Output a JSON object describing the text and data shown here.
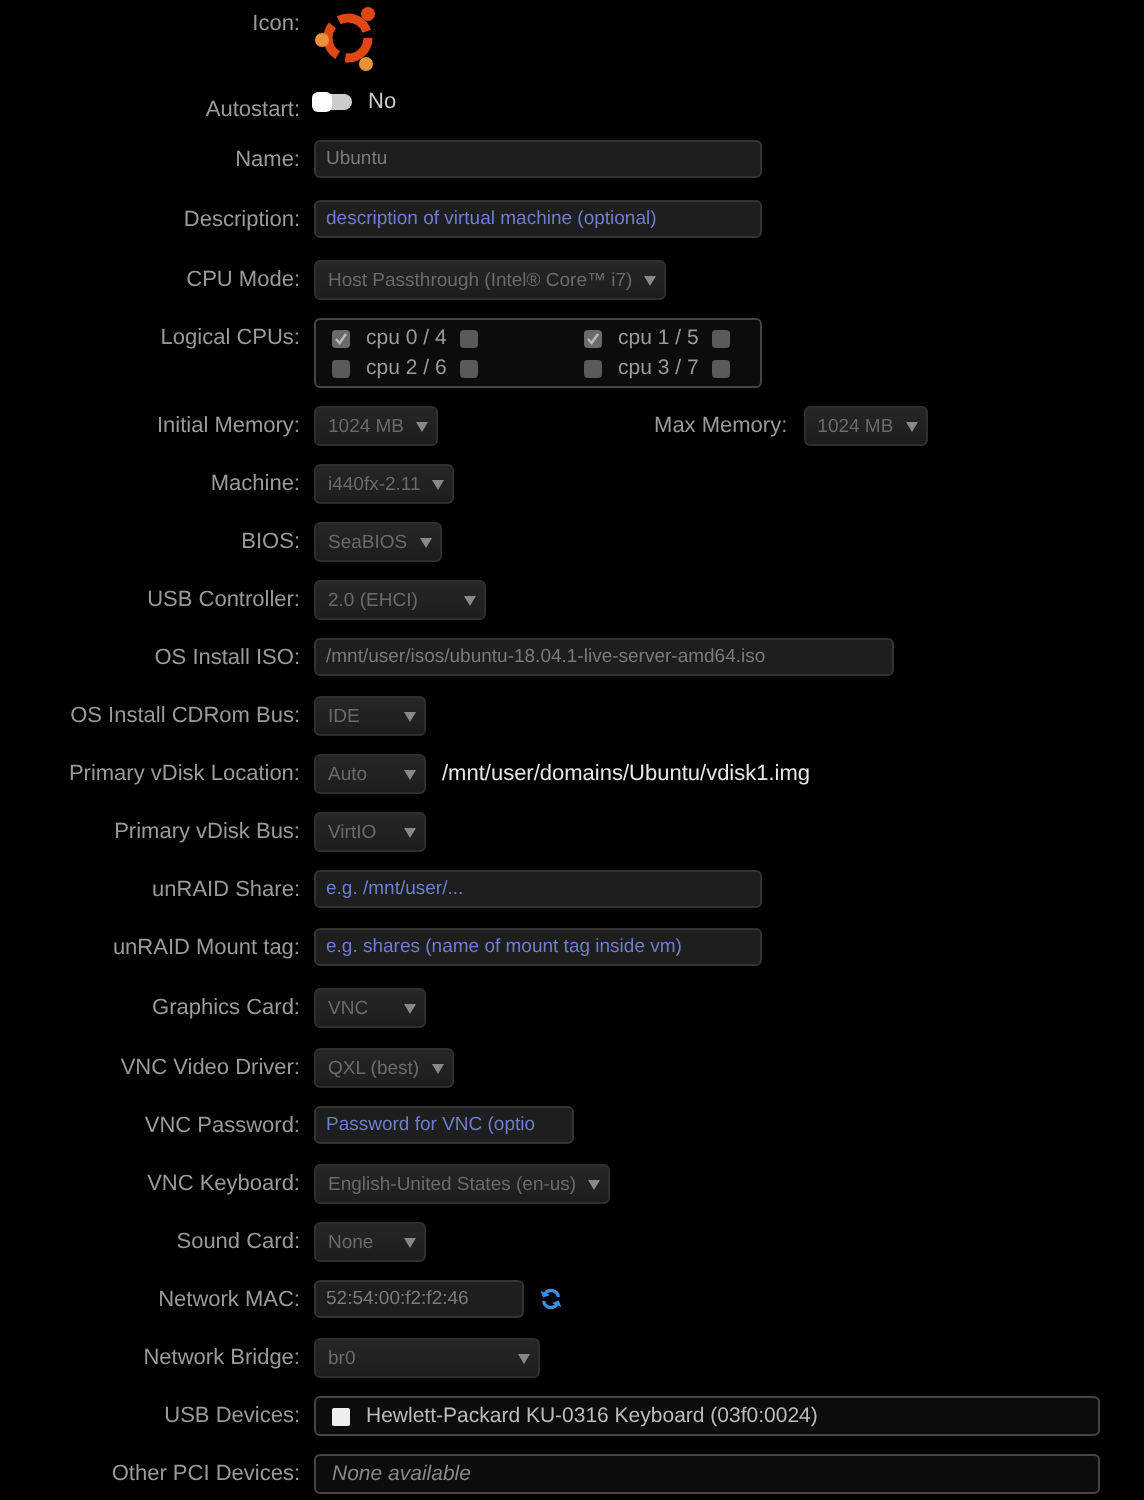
{
  "rows": [
    {
      "kind": "icon",
      "label": "Icon:"
    },
    {
      "kind": "toggle",
      "label": "Autostart:",
      "on": false,
      "state_text": "No"
    },
    {
      "kind": "text",
      "label": "Name:",
      "value": "Ubuntu"
    },
    {
      "kind": "text",
      "label": "Description:",
      "placeholder": "description of virtual machine (optional)"
    },
    {
      "kind": "select",
      "label": "CPU Mode:",
      "value": "Host Passthrough (Intel® Core™ i7)"
    },
    {
      "kind": "cpus",
      "label": "Logical CPUs:",
      "cpus": [
        {
          "label": "cpu 0 / 4",
          "checked": true,
          "sibling_checked": false
        },
        {
          "label": "cpu 1 / 5",
          "checked": true,
          "sibling_checked": false
        },
        {
          "label": "cpu 2 / 6",
          "checked": false,
          "sibling_checked": false
        },
        {
          "label": "cpu 3 / 7",
          "checked": false,
          "sibling_checked": false
        }
      ]
    },
    {
      "kind": "memory",
      "label": "Initial Memory:",
      "value": "1024 MB",
      "max_label": "Max Memory:",
      "max_value": "1024 MB"
    },
    {
      "kind": "select",
      "label": "Machine:",
      "value": "i440fx-2.11"
    },
    {
      "kind": "select",
      "label": "BIOS:",
      "value": "SeaBIOS"
    },
    {
      "kind": "select",
      "label": "USB Controller:",
      "value": "2.0 (EHCI)"
    },
    {
      "kind": "text",
      "label": "OS Install ISO:",
      "value": "/mnt/user/isos/ubuntu-18.04.1-live-server-amd64.iso"
    },
    {
      "kind": "select",
      "label": "OS Install CDRom Bus:",
      "value": "IDE"
    },
    {
      "kind": "select",
      "label": "Primary vDisk Location:",
      "value": "Auto",
      "path": "/mnt/user/domains/Ubuntu/vdisk1.img"
    },
    {
      "kind": "select",
      "label": "Primary vDisk Bus:",
      "value": "VirtIO"
    },
    {
      "kind": "text",
      "label": "unRAID Share:",
      "placeholder": "e.g. /mnt/user/..."
    },
    {
      "kind": "text",
      "label": "unRAID Mount tag:",
      "placeholder": "e.g. shares (name of mount tag inside vm)"
    },
    {
      "kind": "select",
      "label": "Graphics Card:",
      "value": "VNC"
    },
    {
      "kind": "select",
      "label": "VNC Video Driver:",
      "value": "QXL (best)"
    },
    {
      "kind": "text",
      "label": "VNC Password:",
      "placeholder": "Password for VNC (optio"
    },
    {
      "kind": "select",
      "label": "VNC Keyboard:",
      "value": "English-United States (en-us)"
    },
    {
      "kind": "select",
      "label": "Sound Card:",
      "value": "None"
    },
    {
      "kind": "mac",
      "label": "Network MAC:",
      "value": "52:54:00:f2:f2:46"
    },
    {
      "kind": "select",
      "label": "Network Bridge:",
      "value": "br0"
    },
    {
      "kind": "devices",
      "label": "USB Devices:",
      "devices": [
        {
          "label": "Hewlett-Packard KU-0316 Keyboard (03f0:0024)",
          "checked": false
        }
      ]
    },
    {
      "kind": "static",
      "label": "Other PCI Devices:",
      "value": "None available"
    }
  ]
}
